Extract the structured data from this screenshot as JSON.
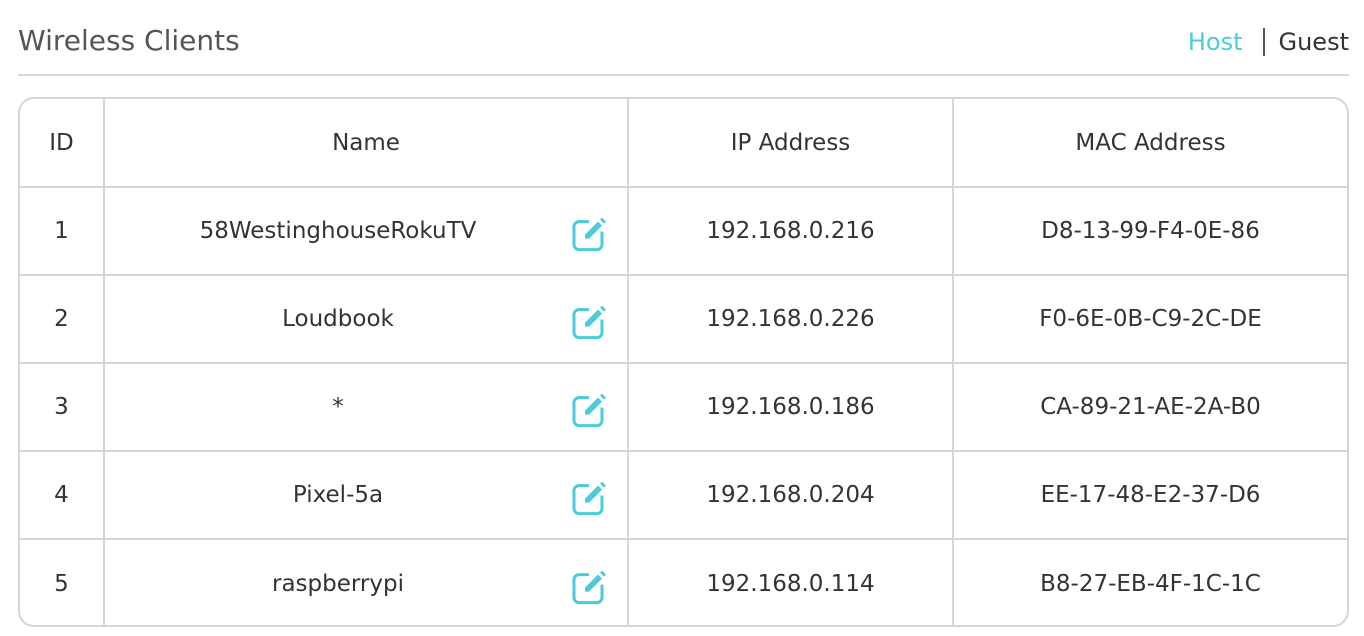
{
  "header": {
    "title": "Wireless Clients",
    "tabs": {
      "host": "Host",
      "guest": "Guest"
    }
  },
  "colors": {
    "accent": "#4acbd6",
    "border": "#d6d6d6",
    "text": "#333333"
  },
  "table": {
    "columns": {
      "id": "ID",
      "name": "Name",
      "ip": "IP Address",
      "mac": "MAC Address"
    },
    "rows": [
      {
        "id": "1",
        "name": "58WestinghouseRokuTV",
        "ip": "192.168.0.216",
        "mac": "D8-13-99-F4-0E-86",
        "edit_icon": "edit-icon"
      },
      {
        "id": "2",
        "name": "Loudbook",
        "ip": "192.168.0.226",
        "mac": "F0-6E-0B-C9-2C-DE",
        "edit_icon": "edit-icon"
      },
      {
        "id": "3",
        "name": "*",
        "ip": "192.168.0.186",
        "mac": "CA-89-21-AE-2A-B0",
        "edit_icon": "edit-icon"
      },
      {
        "id": "4",
        "name": "Pixel-5a",
        "ip": "192.168.0.204",
        "mac": "EE-17-48-E2-37-D6",
        "edit_icon": "edit-icon"
      },
      {
        "id": "5",
        "name": "raspberrypi",
        "ip": "192.168.0.114",
        "mac": "B8-27-EB-4F-1C-1C",
        "edit_icon": "edit-icon"
      }
    ]
  }
}
